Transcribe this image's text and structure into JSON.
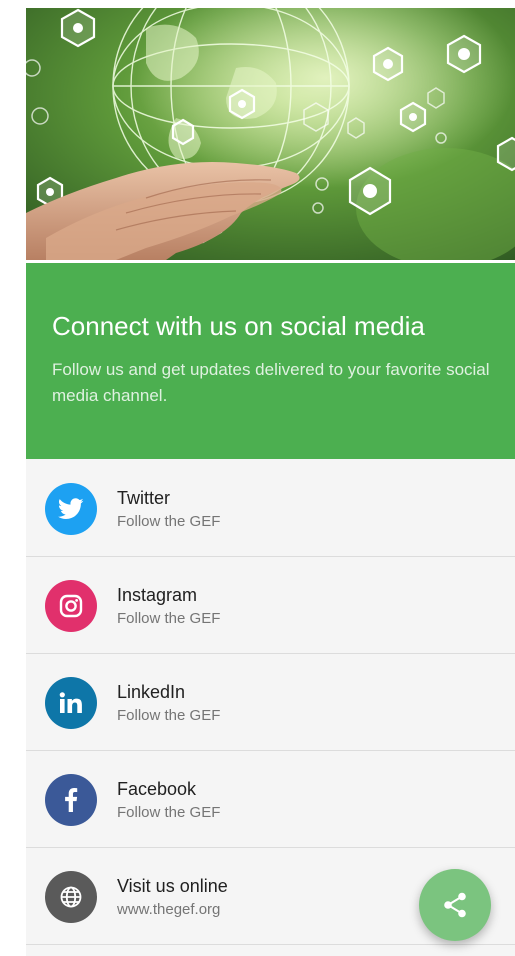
{
  "banner": {
    "title": "Connect with us on social media",
    "text": "Follow us and get updates delivered to your favorite social media channel."
  },
  "social": {
    "items": [
      {
        "name": "Twitter",
        "subtitle": "Follow the GEF",
        "icon": "twitter-bird-icon",
        "color": "#1da1f2"
      },
      {
        "name": "Instagram",
        "subtitle": "Follow the GEF",
        "icon": "instagram-camera-icon",
        "color": "#e1306c"
      },
      {
        "name": "LinkedIn",
        "subtitle": "Follow the GEF",
        "icon": "linkedin-in-icon",
        "color": "#0e76a8"
      },
      {
        "name": "Facebook",
        "subtitle": "Follow the GEF",
        "icon": "facebook-f-icon",
        "color": "#3b5998"
      },
      {
        "name": "Visit us online",
        "subtitle": "www.thegef.org",
        "icon": "globe-icon",
        "color": "#5a5a5a"
      }
    ]
  },
  "fab": {
    "icon": "share-icon",
    "color": "#7bc47f"
  },
  "hero": {
    "description_icon": "globe-hands-icon"
  }
}
